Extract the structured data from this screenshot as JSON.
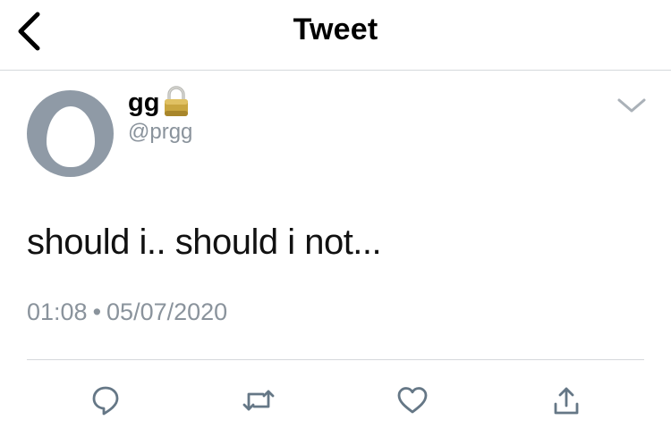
{
  "header": {
    "title": "Tweet",
    "back_icon": "chevron-left-icon"
  },
  "tweet": {
    "author": {
      "display_name": "gg",
      "handle": "@prgg",
      "protected_icon": "lock-icon",
      "avatar": "default-egg-avatar"
    },
    "text": "should i.. should i not...",
    "time": "01:08",
    "separator": "•",
    "date": "05/07/2020",
    "menu_icon": "chevron-down-icon"
  },
  "actions": [
    {
      "name": "reply",
      "icon": "reply-icon"
    },
    {
      "name": "retweet",
      "icon": "retweet-icon"
    },
    {
      "name": "like",
      "icon": "heart-icon"
    },
    {
      "name": "share",
      "icon": "share-icon"
    }
  ],
  "colors": {
    "icon_gray": "#657786",
    "secondary_text": "#8a939c",
    "avatar_bg": "#8f9aa6",
    "divider": "#d5d8db"
  }
}
